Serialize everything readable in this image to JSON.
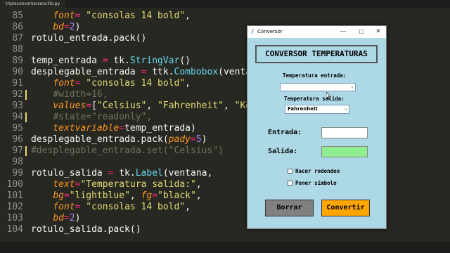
{
  "editor": {
    "tab_title": "tripleconversorsencillo.py",
    "lines": [
      {
        "num": "85",
        "mark": false,
        "tokens": [
          {
            "t": "    "
          },
          {
            "t": "font",
            "c": "prm"
          },
          {
            "t": "= ",
            "c": "op"
          },
          {
            "t": "\"consolas 14 bold\"",
            "c": "str"
          },
          {
            "t": ","
          }
        ]
      },
      {
        "num": "86",
        "mark": false,
        "tokens": [
          {
            "t": "    "
          },
          {
            "t": "bd",
            "c": "prm"
          },
          {
            "t": "=",
            "c": "op"
          },
          {
            "t": "2",
            "c": "num"
          },
          {
            "t": ")"
          }
        ]
      },
      {
        "num": "87",
        "mark": false,
        "tokens": [
          {
            "t": "rotulo_entrada.pack()"
          }
        ]
      },
      {
        "num": "88",
        "mark": false,
        "tokens": []
      },
      {
        "num": "89",
        "mark": false,
        "tokens": [
          {
            "t": "temp_entrada "
          },
          {
            "t": "=",
            "c": "op"
          },
          {
            "t": " tk."
          },
          {
            "t": "StringVar",
            "c": "fn"
          },
          {
            "t": "()"
          }
        ]
      },
      {
        "num": "90",
        "mark": false,
        "tokens": [
          {
            "t": "desplegable_entrada "
          },
          {
            "t": "=",
            "c": "op"
          },
          {
            "t": " ttk."
          },
          {
            "t": "Combobox",
            "c": "fn"
          },
          {
            "t": "(ventana,"
          }
        ]
      },
      {
        "num": "91",
        "mark": false,
        "tokens": [
          {
            "t": "    "
          },
          {
            "t": "font",
            "c": "prm"
          },
          {
            "t": "= ",
            "c": "op"
          },
          {
            "t": "\"consolas 14 bold\"",
            "c": "str"
          },
          {
            "t": ","
          }
        ]
      },
      {
        "num": "92",
        "mark": true,
        "tokens": [
          {
            "t": "    "
          },
          {
            "t": "#width=16,",
            "c": "cmt"
          }
        ]
      },
      {
        "num": "93",
        "mark": false,
        "tokens": [
          {
            "t": "    "
          },
          {
            "t": "values",
            "c": "prm"
          },
          {
            "t": "=",
            "c": "op"
          },
          {
            "t": "["
          },
          {
            "t": "\"Celsius\"",
            "c": "str"
          },
          {
            "t": ", "
          },
          {
            "t": "\"Fahrenheit\"",
            "c": "str"
          },
          {
            "t": ", "
          },
          {
            "t": "\"Kelvin\"",
            "c": "str"
          }
        ]
      },
      {
        "num": "94",
        "mark": true,
        "tokens": [
          {
            "t": "    "
          },
          {
            "t": "#state=\"readonly\",",
            "c": "cmt"
          }
        ]
      },
      {
        "num": "95",
        "mark": false,
        "tokens": [
          {
            "t": "    "
          },
          {
            "t": "textvariable",
            "c": "prm"
          },
          {
            "t": "=",
            "c": "op"
          },
          {
            "t": "temp_entrada)"
          }
        ]
      },
      {
        "num": "96",
        "mark": false,
        "tokens": [
          {
            "t": "desplegable_entrada.pack("
          },
          {
            "t": "pady",
            "c": "prm"
          },
          {
            "t": "=",
            "c": "op"
          },
          {
            "t": "5",
            "c": "num"
          },
          {
            "t": ")"
          }
        ]
      },
      {
        "num": "97",
        "mark": true,
        "tokens": [
          {
            "t": "#desplegable_entrada.set(\"Celsius\")",
            "c": "cmt"
          }
        ]
      },
      {
        "num": "98",
        "mark": false,
        "tokens": []
      },
      {
        "num": "99",
        "mark": false,
        "tokens": [
          {
            "t": "rotulo_salida "
          },
          {
            "t": "=",
            "c": "op"
          },
          {
            "t": " tk."
          },
          {
            "t": "Label",
            "c": "fn"
          },
          {
            "t": "(ventana,"
          }
        ]
      },
      {
        "num": "100",
        "mark": false,
        "tokens": [
          {
            "t": "    "
          },
          {
            "t": "text",
            "c": "prm"
          },
          {
            "t": "=",
            "c": "op"
          },
          {
            "t": "\"Temperatura salida:\"",
            "c": "str"
          },
          {
            "t": ","
          }
        ]
      },
      {
        "num": "101",
        "mark": false,
        "tokens": [
          {
            "t": "    "
          },
          {
            "t": "bg",
            "c": "prm"
          },
          {
            "t": "=",
            "c": "op"
          },
          {
            "t": "\"lightblue\"",
            "c": "str"
          },
          {
            "t": ", "
          },
          {
            "t": "fg",
            "c": "prm"
          },
          {
            "t": "=",
            "c": "op"
          },
          {
            "t": "\"black\"",
            "c": "str"
          },
          {
            "t": ","
          }
        ]
      },
      {
        "num": "102",
        "mark": false,
        "tokens": [
          {
            "t": "    "
          },
          {
            "t": "font",
            "c": "prm"
          },
          {
            "t": "= ",
            "c": "op"
          },
          {
            "t": "\"consolas 14 bold\"",
            "c": "str"
          },
          {
            "t": ","
          }
        ]
      },
      {
        "num": "103",
        "mark": false,
        "tokens": [
          {
            "t": "    "
          },
          {
            "t": "bd",
            "c": "prm"
          },
          {
            "t": "=",
            "c": "op"
          },
          {
            "t": "2",
            "c": "num"
          },
          {
            "t": ")"
          }
        ]
      },
      {
        "num": "104",
        "mark": false,
        "tokens": [
          {
            "t": "rotulo_salida.pack()"
          }
        ]
      }
    ]
  },
  "window": {
    "title": "Conversor",
    "minimize": "—",
    "maximize": "☐",
    "close": "✕",
    "heading": "CONVERSOR TEMPERATURAS",
    "temp_entrada_label": "Temperatura entrada:",
    "combo_entrada_value": "",
    "temp_salida_label": "Temperatura salida:",
    "combo_salida_value": "Fahrenheit",
    "entrada_label": "Entrada:",
    "entrada_value": "",
    "salida_label": "Salida:",
    "salida_value": "",
    "check_redondeo": "Hacer redondeo",
    "check_simbolo": "Poner símbolo",
    "borrar_button": "Borrar",
    "convertir_button": "Convertir"
  },
  "colors": {
    "editor_bg": "#272822",
    "window_bg": "#add8e6",
    "salida_bg": "#90ee90",
    "borrar_bg": "#808080",
    "convertir_bg": "#ffa500"
  }
}
